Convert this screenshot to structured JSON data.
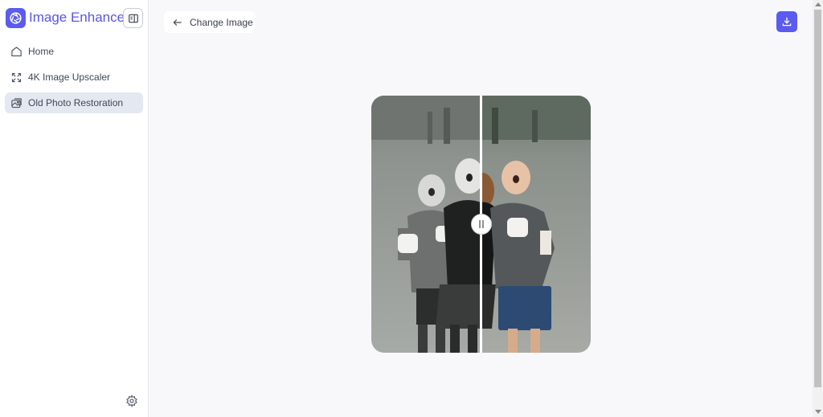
{
  "app": {
    "title": "Image Enhancer",
    "logo_icon": "aperture-icon",
    "accent_color": "#5b5bf0"
  },
  "sidebar": {
    "items": [
      {
        "label": "Home",
        "icon": "home-icon",
        "active": false
      },
      {
        "label": "4K Image Upscaler",
        "icon": "expand-icon",
        "active": false
      },
      {
        "label": "Old Photo Restoration",
        "icon": "photo-restore-icon",
        "active": true
      }
    ],
    "settings_icon": "gear-icon"
  },
  "toolbar": {
    "change_image_label": "Change Image",
    "download_icon": "download-icon"
  },
  "comparison": {
    "left_state": "original (black & white)",
    "right_state": "restored (colorized)",
    "slider_position": 0.5
  }
}
